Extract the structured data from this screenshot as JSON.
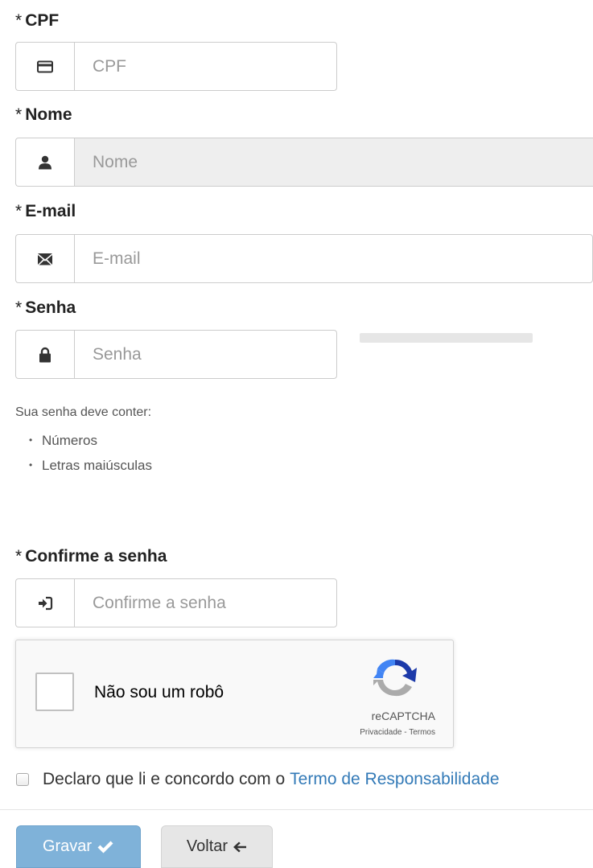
{
  "form": {
    "required_mark": "*",
    "cpf": {
      "label": "CPF",
      "placeholder": "CPF",
      "icon": "credit-card-icon"
    },
    "nome": {
      "label": "Nome",
      "placeholder": "Nome",
      "icon": "user-icon"
    },
    "email": {
      "label": "E-mail",
      "placeholder": "E-mail",
      "icon": "envelope-icon"
    },
    "senha": {
      "label": "Senha",
      "placeholder": "Senha",
      "icon": "lock-icon"
    },
    "password_hint": {
      "title": "Sua senha deve conter:",
      "items": [
        "Números",
        "Letras maiúsculas"
      ]
    },
    "confirm": {
      "label": "Confirme a senha",
      "placeholder": "Confirme a senha",
      "icon": "sign-in-icon"
    }
  },
  "recaptcha": {
    "label": "Não sou um robô",
    "brand": "reCAPTCHA",
    "privacy": "Privacidade",
    "separator": "-",
    "terms": "Termos"
  },
  "agreement": {
    "text": "Declaro que li e concordo com o",
    "link": "Termo de Responsabilidade"
  },
  "actions": {
    "save_label": "Gravar",
    "back_label": "Voltar"
  },
  "colors": {
    "primary": "#7fb2d9",
    "link": "#337ab7"
  }
}
